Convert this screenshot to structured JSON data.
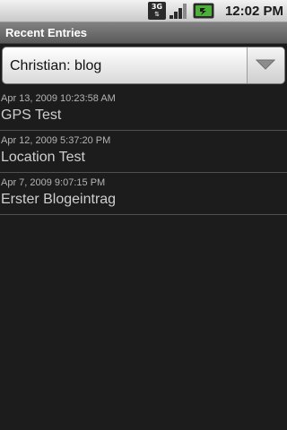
{
  "status_bar": {
    "network_type": "3G",
    "network_arrows": "⇅",
    "time": "12:02 PM"
  },
  "title_bar": {
    "title": "Recent Entries"
  },
  "spinner": {
    "selected": "Christian: blog"
  },
  "entries": [
    {
      "date": "Apr 13, 2009 10:23:58 AM",
      "title": "GPS Test"
    },
    {
      "date": "Apr 12, 2009 5:37:20 PM",
      "title": "Location Test"
    },
    {
      "date": "Apr 7, 2009 9:07:15 PM",
      "title": "Erster Blogeintrag"
    }
  ],
  "colors": {
    "background": "#1c1c1c",
    "divider": "#505050",
    "battery_charge": "#4caf3a"
  }
}
